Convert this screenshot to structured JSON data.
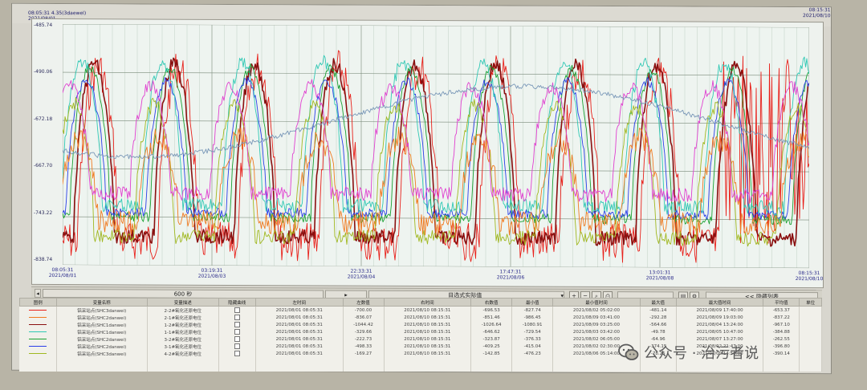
{
  "window": {
    "tag_left": "08:05:31 4.35(3daewel)",
    "tag_left_date": "2021/08/01",
    "tag_right": "08:15:31",
    "tag_right_date": "2021/08/10"
  },
  "chart_data": {
    "type": "line",
    "title": "",
    "y_ticks": [
      "-485.74",
      "-490.06",
      "-672.18",
      "-667.70",
      "-743.22",
      "-838.74"
    ],
    "x_ticks": [
      {
        "time": "08:05:31",
        "date": "2021/08/01"
      },
      {
        "time": "03:19:31",
        "date": "2021/08/03"
      },
      {
        "time": "22:33:31",
        "date": "2021/08/04"
      },
      {
        "time": "17:47:31",
        "date": "2021/08/06"
      },
      {
        "time": "13:01:31",
        "date": "2021/08/08"
      },
      {
        "time": "08:15:31",
        "date": "2021/08/10"
      }
    ],
    "ylim": [
      -838.74,
      -485.74
    ],
    "grid": true,
    "series": [
      {
        "color": "#e8201a"
      },
      {
        "color": "#8a1010"
      },
      {
        "color": "#1aa032"
      },
      {
        "color": "#2a3ee8"
      },
      {
        "color": "#30c8b4"
      },
      {
        "color": "#f07a20"
      },
      {
        "color": "#a0b820"
      },
      {
        "color": "#e040d0"
      },
      {
        "color": "#7a98b8"
      }
    ]
  },
  "controls": {
    "interval": "600 秒",
    "display_mode": "目选式实际值",
    "hide_list": "<< 隐藏列表"
  },
  "table": {
    "headers": [
      "图例",
      "变量名称",
      "变量描述",
      "隐藏曲线",
      "左时间",
      "左数值",
      "右时间",
      "右数值",
      "最小值",
      "最小值时间",
      "最大值",
      "最大值时间",
      "平均值",
      "单位"
    ],
    "rows": [
      {
        "color": "#e8201a",
        "name": "铝采站点(SHC3danwei)",
        "desc": "2-2#氧化还原电位",
        "left_time": "2021/08/01 08:05:31",
        "left_val": "-700.00",
        "right_time": "2021/08/10 08:15:31",
        "right_val": "-696.53",
        "min": "-827.74",
        "min_time": "2021/08/02 05:02:00",
        "max": "-481.14",
        "max_time": "2021/08/09 17:40:00",
        "avg": "-653.37"
      },
      {
        "color": "#f07a20",
        "name": "铝采站点(SHC2danwei)",
        "desc": "2-1#氧化还原电位",
        "left_time": "2021/08/01 08:05:31",
        "left_val": "-836.07",
        "right_time": "2021/08/10 08:15:31",
        "right_val": "-851.46",
        "min": "-986.45",
        "min_time": "2021/08/09 03:41:00",
        "max": "-292.28",
        "max_time": "2021/08/09 19:03:00",
        "avg": "-837.22"
      },
      {
        "color": "#8a1010",
        "name": "铝采站点(SHC1danwei)",
        "desc": "1-2#氧化还原电位",
        "left_time": "2021/08/01 08:05:31",
        "left_val": "-1044.42",
        "right_time": "2021/08/10 08:15:31",
        "right_val": "-1026.64",
        "min": "-1080.91",
        "min_time": "2021/08/09 03:25:00",
        "max": "-564.66",
        "max_time": "2021/08/04 13:24:00",
        "avg": "-967.10"
      },
      {
        "color": "#30c8b4",
        "name": "铝采站点(SHC1danwei)",
        "desc": "1-1#氧化还原电位",
        "left_time": "2021/08/01 08:05:31",
        "left_val": "-329.66",
        "right_time": "2021/08/10 08:15:31",
        "right_val": "-646.62",
        "min": "-729.54",
        "min_time": "2021/08/03 03:42:00",
        "max": "-49.78",
        "max_time": "2021/08/05 10:47:00",
        "avg": "-384.88"
      },
      {
        "color": "#1aa032",
        "name": "铝采站点(SHC2danwei)",
        "desc": "3-2#氧化还原电位",
        "left_time": "2021/08/01 08:05:31",
        "left_val": "-222.73",
        "right_time": "2021/08/10 08:15:31",
        "right_val": "-323.87",
        "min": "-376.33",
        "min_time": "2021/08/02 06:05:00",
        "max": "-64.96",
        "max_time": "2021/08/07 13:27:00",
        "avg": "-262.55"
      },
      {
        "color": "#2a3ee8",
        "name": "铝采站点(SHC2danwei)",
        "desc": "3-1#氧化还原电位",
        "left_time": "2021/08/01 08:05:31",
        "left_val": "-498.33",
        "right_time": "2021/08/10 08:15:31",
        "right_val": "-409.25",
        "min": "-415.04",
        "min_time": "2021/08/02 02:30:00",
        "max": "-374.15",
        "max_time": "2021/08/02 21:47:00",
        "avg": "-396.80"
      },
      {
        "color": "#a0b820",
        "name": "铝采站点(SHC3danwei)",
        "desc": "4-2#氧化还原电位",
        "left_time": "2021/08/01 08:05:31",
        "left_val": "-169.27",
        "right_time": "2021/08/10 08:15:31",
        "right_val": "-142.85",
        "min": "-476.23",
        "min_time": "2021/08/06 05:14:00",
        "max": "-78.25",
        "max_time": "2021/08/09 14:55:00",
        "avg": "-390.14"
      }
    ]
  },
  "watermark": {
    "text": "公众号 · 治污者说"
  }
}
